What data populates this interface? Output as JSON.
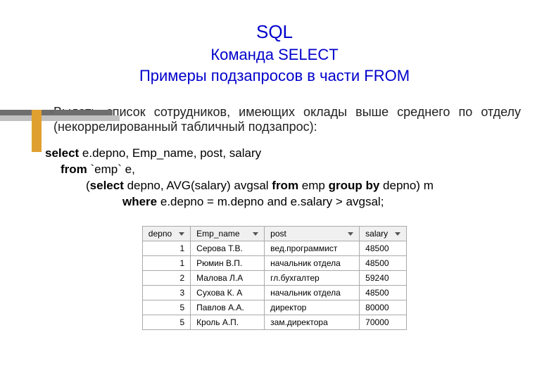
{
  "title": {
    "line1": "SQL",
    "line2": "Команда SELECT",
    "line3": "Примеры подзапросов в части FROM"
  },
  "bullet": {
    "text": "Выдать список сотрудников, имеющих оклады выше среднего по отделу (некоррелированный табличный подзапрос):"
  },
  "code": {
    "kw_select": "select",
    "l1_rest": " e.depno, Emp_name, post, salary",
    "kw_from": "from",
    "l2_rest": " `emp` e,",
    "l3_open": "(",
    "kw_select2": "select",
    "l3_mid": "  depno, AVG(salary) avgsal ",
    "kw_from2": "from",
    "l3_mid2": " emp ",
    "kw_groupby": "group by",
    "l3_end": " depno) m",
    "kw_where": "where",
    "l4_rest": " e.depno = m.depno and e.salary > avgsal;"
  },
  "table": {
    "headers": [
      "depno",
      "Emp_name",
      "post",
      "salary"
    ],
    "rows": [
      {
        "depno": "1",
        "emp": "Серова Т.В.",
        "post": "вед.программист",
        "salary": "48500"
      },
      {
        "depno": "1",
        "emp": "Рюмин В.П.",
        "post": "начальник отдела",
        "salary": "48500"
      },
      {
        "depno": "2",
        "emp": "Малова Л.А",
        "post": "гл.бухгалтер",
        "salary": "59240"
      },
      {
        "depno": "3",
        "emp": "Сухова К. А",
        "post": "начальник отдела",
        "salary": "48500"
      },
      {
        "depno": "5",
        "emp": "Павлов А.А.",
        "post": "директор",
        "salary": "80000"
      },
      {
        "depno": "5",
        "emp": "Кроль А.П.",
        "post": "зам.директора",
        "salary": "70000"
      }
    ]
  }
}
